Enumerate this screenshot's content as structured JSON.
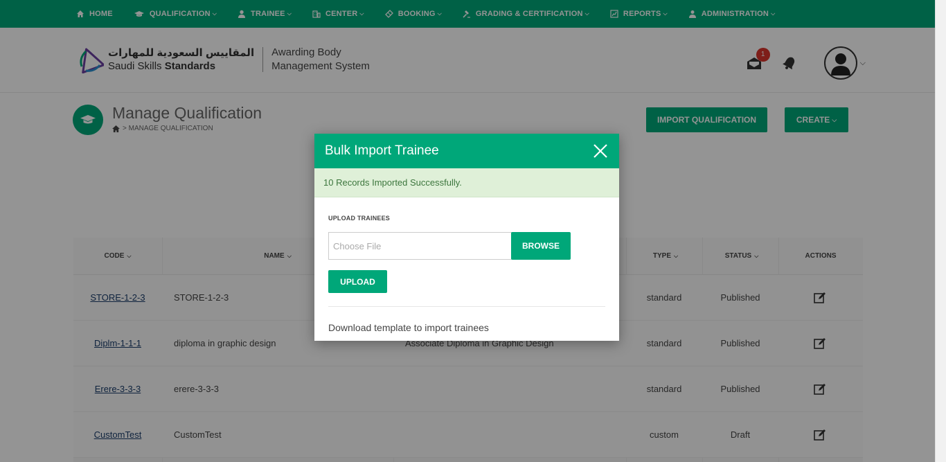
{
  "nav": {
    "items": [
      {
        "label": "HOME",
        "icon": "home-icon"
      },
      {
        "label": "QUALIFICATION",
        "icon": "graduation-cap-icon"
      },
      {
        "label": "TRAINEE",
        "icon": "user-icon"
      },
      {
        "label": "CENTER",
        "icon": "building-icon"
      },
      {
        "label": "BOOKING",
        "icon": "ticket-icon"
      },
      {
        "label": "GRADING & CERTIFICATION",
        "icon": "gavel-icon"
      },
      {
        "label": "REPORTS",
        "icon": "chart-icon"
      },
      {
        "label": "ADMINISTRATION",
        "icon": "admin-user-icon"
      }
    ]
  },
  "header": {
    "logo_arabic": "المقاييس السعودية للمهارات",
    "logo_english_1": "Saudi Skills ",
    "logo_english_2": "Standards",
    "system_line1": "Awarding Body",
    "system_line2": "Management System",
    "mail_badge": "1"
  },
  "page": {
    "title": "Manage Qualification",
    "breadcrumb": "> MANAGE QUALIFICATION",
    "import_button": "IMPORT QUALIFICATION",
    "create_button": "CREATE"
  },
  "table": {
    "headers": {
      "code": "CODE",
      "name": "NAME",
      "type": "TYPE",
      "status": "STATUS",
      "actions": "ACTIONS"
    },
    "rows": [
      {
        "code": "STORE-1-2-3",
        "name": "STORE-1-2-3",
        "title": "",
        "type": "standard",
        "status": "Published"
      },
      {
        "code": "Diplm-1-1-1",
        "name": "diploma in graphic design",
        "title": "Associate Diploma in Graphic Design",
        "type": "standard",
        "status": "Published"
      },
      {
        "code": "Erere-3-3-3",
        "name": "erere-3-3-3",
        "title": "",
        "type": "standard",
        "status": "Published"
      },
      {
        "code": "CustomTest",
        "name": "CustomTest",
        "title": "",
        "type": "custom",
        "status": "Draft"
      }
    ]
  },
  "modal": {
    "title": "Bulk Import Trainee",
    "alert": "10 Records Imported Successfully.",
    "field_label": "UPLOAD TRAINEES",
    "file_placeholder": "Choose File",
    "browse_button": "BROWSE",
    "upload_button": "UPLOAD",
    "template_link": "Download template to import trainees"
  },
  "colors": {
    "brand_green": "#00a779",
    "badge_red": "#d9342b",
    "alert_bg": "#dff0d8"
  }
}
